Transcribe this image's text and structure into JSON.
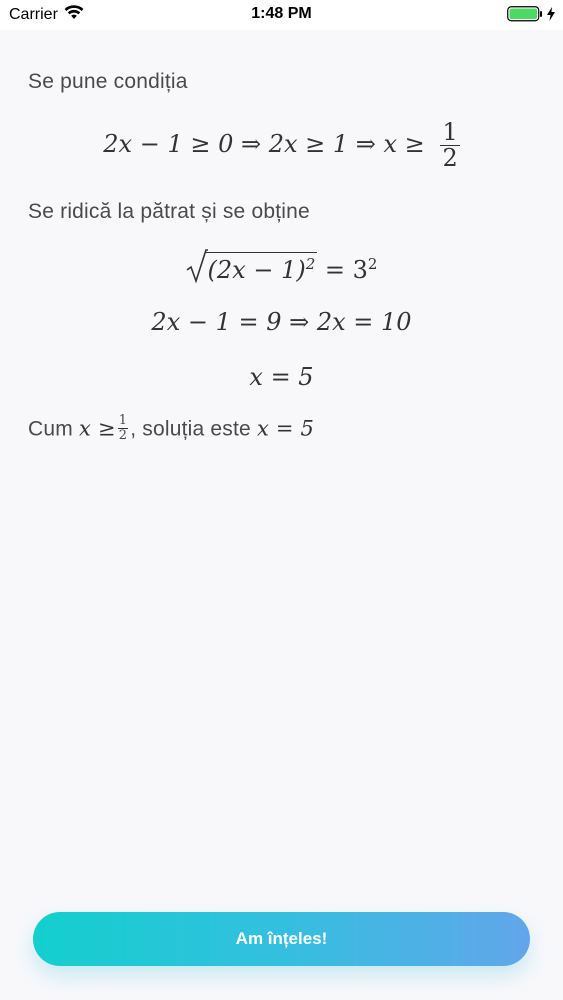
{
  "status_bar": {
    "carrier": "Carrier",
    "time": "1:48 PM",
    "icons": [
      "wifi-icon",
      "battery-icon",
      "charging-bolt-icon"
    ]
  },
  "content": {
    "line1": "Se pune condiția",
    "math1": {
      "expr": "2x − 1 ≥ 0 ⇒ 2x ≥ 1 ⇒ x ≥",
      "frac_num": "1",
      "frac_den": "2"
    },
    "line2": "Se ridică la pătrat și se obține",
    "math2": {
      "radicand": "(2x − 1)",
      "radicand_exp": "2",
      "rhs": "= 3",
      "rhs_exp": "2"
    },
    "math3": "2x − 1 = 9 ⇒ 2x = 10",
    "math4": "x = 5",
    "line3": {
      "prefix": "Cum",
      "cond": "x ≥",
      "frac_num": "1",
      "frac_den": "2",
      "suffix": ", soluția este",
      "result": "x = 5"
    }
  },
  "actions": {
    "primary_label": "Am înțeles!"
  },
  "colors": {
    "background": "#f8f8fb",
    "text": "#4a4a4a",
    "button_gradient_start": "#13cfcd",
    "button_gradient_end": "#62a6ea"
  }
}
